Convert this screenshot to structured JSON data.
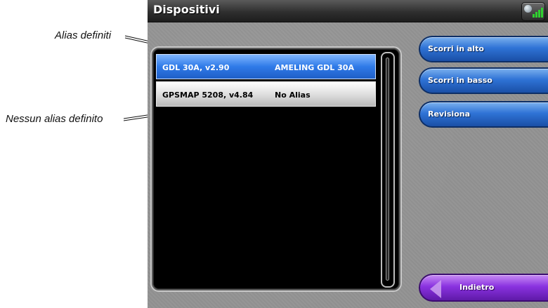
{
  "callouts": {
    "alias_defined": "Alias definiti",
    "no_alias_defined": "Nessun alias definito"
  },
  "screen": {
    "title": "Dispositivi",
    "status_icon": "gps-signal-icon"
  },
  "devices": [
    {
      "name": "GDL 30A, v2.90",
      "alias": "AMELING GDL 30A",
      "selected": true
    },
    {
      "name": "GPSMAP 5208, v4.84",
      "alias": "No Alias",
      "selected": false
    }
  ],
  "buttons": {
    "scroll_up": "Scorri in alto",
    "scroll_down": "Scorri in basso",
    "review": "Revisiona",
    "back": "Indietro"
  },
  "colors": {
    "button_blue": "#2f73d6",
    "button_purple": "#8a32e0",
    "selected_row": "#2f7ae8"
  }
}
